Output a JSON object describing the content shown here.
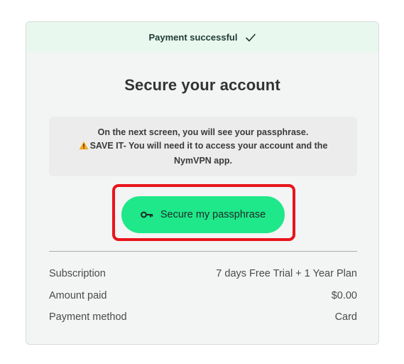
{
  "banner": {
    "text": "Payment successful",
    "icon": "check-icon"
  },
  "title": "Secure your account",
  "notice": {
    "line1": "On the next screen, you will see your passphrase.",
    "line2": "SAVE IT- You will need it to access your account and the NymVPN app.",
    "icon": "warning-icon",
    "warning_color": "#f5a623"
  },
  "cta": {
    "label": "Secure my passphrase",
    "icon": "key-icon",
    "color": "#1ee889",
    "highlight_color": "#e8141b"
  },
  "details": [
    {
      "label": "Subscription",
      "value": "7 days Free Trial + 1 Year Plan"
    },
    {
      "label": "Amount paid",
      "value": "$0.00"
    },
    {
      "label": "Payment method",
      "value": "Card"
    }
  ]
}
